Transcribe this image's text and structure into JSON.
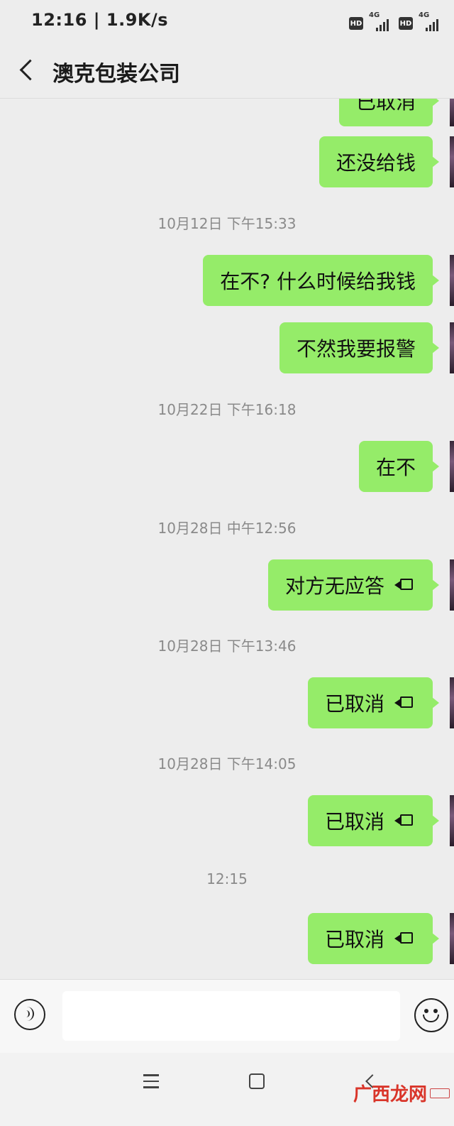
{
  "status_bar": {
    "time": "12:16 | 1.9K/s",
    "hd_1": "HD",
    "network_1": "4G",
    "hd_2": "HD",
    "network_2": "4G"
  },
  "header": {
    "title": "澳克包装公司"
  },
  "messages": [
    {
      "kind": "bubble",
      "text": "已取消"
    },
    {
      "kind": "bubble",
      "text": "还没给钱"
    },
    {
      "kind": "time",
      "text": "10月12日 下午15:33"
    },
    {
      "kind": "bubble",
      "text": "在不? 什么时候给我钱"
    },
    {
      "kind": "bubble",
      "text": "不然我要报警"
    },
    {
      "kind": "time",
      "text": "10月22日 下午16:18"
    },
    {
      "kind": "bubble",
      "text": "在不"
    },
    {
      "kind": "time",
      "text": "10月28日 中午12:56"
    },
    {
      "kind": "call",
      "text": "对方无应答",
      "icon": "video-call-icon"
    },
    {
      "kind": "time",
      "text": "10月28日 下午13:46"
    },
    {
      "kind": "call",
      "text": "已取消",
      "icon": "video-call-icon"
    },
    {
      "kind": "time",
      "text": "10月28日 下午14:05"
    },
    {
      "kind": "call",
      "text": "已取消",
      "icon": "video-call-icon"
    },
    {
      "kind": "time",
      "text": "12:15"
    },
    {
      "kind": "call",
      "text": "已取消",
      "icon": "video-call-icon"
    }
  ],
  "input_bar": {
    "value": "",
    "voice_icon": "voice-icon",
    "emoji_icon": "emoji-icon"
  },
  "system_nav": {
    "menu_icon": "menu-icon",
    "home_icon": "home-icon",
    "back_icon": "back-icon"
  },
  "watermark": {
    "logo": "广西龙网"
  },
  "colors": {
    "background": "#ededed",
    "bubble_green": "#95ec69",
    "timestamp_gray": "#8a8a8a",
    "watermark_red": "#d9352a"
  }
}
